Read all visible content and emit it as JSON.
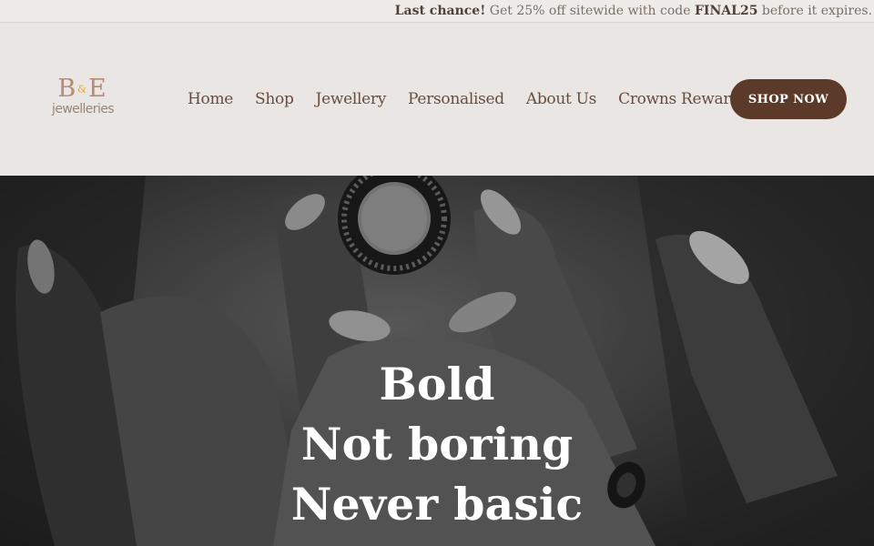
{
  "announcement": {
    "lead": "Last chance!",
    "text_before": " Get 25% off sitewide with code ",
    "code": "FINAL25",
    "text_after": " before it expires."
  },
  "logo": {
    "letters_left": "B",
    "ampersand": "&",
    "letters_right": "E",
    "word": "jewelleries"
  },
  "nav": {
    "items": [
      {
        "label": "Home"
      },
      {
        "label": "Shop"
      },
      {
        "label": "Jewellery"
      },
      {
        "label": "Personalised"
      },
      {
        "label": "About Us"
      },
      {
        "label": "Crowns Rewards"
      }
    ]
  },
  "cta": {
    "label": "SHOP NOW"
  },
  "hero": {
    "lines": [
      "Bold",
      "Not boring",
      "Never basic"
    ]
  },
  "colors": {
    "brand_brown": "#5b3a2a",
    "nav_text": "#6a4c3b",
    "header_bg": "#e9e6e3",
    "logo_gold": "#d9a73b"
  }
}
